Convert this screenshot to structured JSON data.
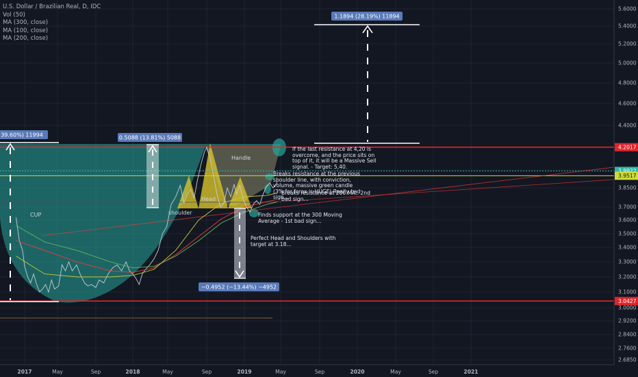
{
  "header": {
    "title": "U.S. Dollar / Brazilian Real, D, IDC",
    "indicators": [
      "Vol (50)",
      "MA (300, close)",
      "MA (100, close)",
      "MA (200, close)"
    ]
  },
  "chart_data": {
    "type": "line",
    "ylim": [
      2.66,
      5.67
    ],
    "y_ticks": [
      2.685,
      2.76,
      2.84,
      2.92,
      3.0,
      3.1,
      3.2,
      3.3,
      3.4,
      3.5,
      3.6,
      3.7,
      3.85,
      4.0,
      4.2,
      4.4,
      4.6,
      4.8,
      5.0,
      5.2,
      5.4,
      5.6
    ],
    "x_ticks": [
      "2017",
      "May",
      "Sep",
      "2018",
      "May",
      "Sep",
      "2019",
      "May",
      "Sep",
      "2020",
      "May",
      "Sep",
      "2021"
    ],
    "price_tags": [
      {
        "value": "4.2017",
        "color": "#e0262b"
      },
      {
        "value": "3.9922",
        "color": "#2fb7a8"
      },
      {
        "value": "3.9517",
        "color": "#cddc39"
      },
      {
        "value": "3.0427",
        "color": "#e0262b"
      }
    ],
    "measure_boxes": [
      {
        "label": "1.1894 (28.19%) 11894"
      },
      {
        "label": "39.60%) 11994"
      },
      {
        "label": "0.5088 (13.81%) 5088"
      },
      {
        "label": "−0.4952 (−13.44%) −4952"
      }
    ],
    "series": [
      {
        "name": "",
        "kind": "price",
        "color": "#c7ccd6",
        "points": [
          [
            2016.92,
            3.62
          ],
          [
            2016.95,
            3.45
          ],
          [
            2016.98,
            3.38
          ],
          [
            2017.0,
            3.27
          ],
          [
            2017.03,
            3.2
          ],
          [
            2017.06,
            3.16
          ],
          [
            2017.09,
            3.22
          ],
          [
            2017.12,
            3.15
          ],
          [
            2017.15,
            3.1
          ],
          [
            2017.18,
            3.12
          ],
          [
            2017.21,
            3.15
          ],
          [
            2017.24,
            3.1
          ],
          [
            2017.27,
            3.18
          ],
          [
            2017.3,
            3.12
          ],
          [
            2017.34,
            3.14
          ],
          [
            2017.37,
            3.28
          ],
          [
            2017.4,
            3.24
          ],
          [
            2017.43,
            3.3
          ],
          [
            2017.46,
            3.24
          ],
          [
            2017.5,
            3.28
          ],
          [
            2017.53,
            3.22
          ],
          [
            2017.57,
            3.16
          ],
          [
            2017.6,
            3.14
          ],
          [
            2017.63,
            3.15
          ],
          [
            2017.67,
            3.13
          ],
          [
            2017.7,
            3.18
          ],
          [
            2017.74,
            3.16
          ],
          [
            2017.78,
            3.22
          ],
          [
            2017.82,
            3.26
          ],
          [
            2017.86,
            3.28
          ],
          [
            2017.9,
            3.24
          ],
          [
            2017.94,
            3.3
          ],
          [
            2017.97,
            3.24
          ],
          [
            2018.0,
            3.22
          ],
          [
            2018.03,
            3.19
          ],
          [
            2018.06,
            3.15
          ],
          [
            2018.09,
            3.22
          ],
          [
            2018.12,
            3.25
          ],
          [
            2018.16,
            3.28
          ],
          [
            2018.2,
            3.32
          ],
          [
            2018.24,
            3.38
          ],
          [
            2018.28,
            3.5
          ],
          [
            2018.32,
            3.55
          ],
          [
            2018.36,
            3.72
          ],
          [
            2018.4,
            3.78
          ],
          [
            2018.44,
            3.87
          ],
          [
            2018.47,
            3.73
          ],
          [
            2018.5,
            3.8
          ],
          [
            2018.53,
            3.84
          ],
          [
            2018.56,
            3.77
          ],
          [
            2018.59,
            3.92
          ],
          [
            2018.62,
            4.05
          ],
          [
            2018.65,
            4.16
          ],
          [
            2018.67,
            4.2
          ],
          [
            2018.7,
            4.1
          ],
          [
            2018.73,
            3.95
          ],
          [
            2018.76,
            3.8
          ],
          [
            2018.79,
            3.7
          ],
          [
            2018.82,
            3.73
          ],
          [
            2018.85,
            3.85
          ],
          [
            2018.88,
            3.78
          ],
          [
            2018.91,
            3.88
          ],
          [
            2018.93,
            3.8
          ],
          [
            2018.96,
            3.87
          ],
          [
            2018.99,
            3.76
          ],
          [
            2019.02,
            3.7
          ],
          [
            2019.05,
            3.66
          ],
          [
            2019.08,
            3.72
          ],
          [
            2019.11,
            3.75
          ],
          [
            2019.14,
            3.72
          ],
          [
            2019.17,
            3.8
          ],
          [
            2019.2,
            3.86
          ],
          [
            2019.23,
            3.89
          ],
          [
            2019.26,
            3.85
          ],
          [
            2019.29,
            3.88
          ],
          [
            2019.3,
            3.91
          ]
        ]
      },
      {
        "name": "",
        "kind": "ma",
        "color": "#ef3b3b",
        "points": [
          [
            2016.92,
            3.45
          ],
          [
            2017.2,
            3.38
          ],
          [
            2017.5,
            3.3
          ],
          [
            2017.8,
            3.24
          ],
          [
            2018.0,
            3.23
          ],
          [
            2018.2,
            3.26
          ],
          [
            2018.4,
            3.35
          ],
          [
            2018.6,
            3.48
          ],
          [
            2018.8,
            3.61
          ],
          [
            2019.0,
            3.7
          ],
          [
            2019.2,
            3.74
          ],
          [
            2019.3,
            3.76
          ]
        ]
      },
      {
        "name": "",
        "kind": "ma",
        "color": "#c6c93a",
        "points": [
          [
            2016.92,
            3.34
          ],
          [
            2017.2,
            3.22
          ],
          [
            2017.5,
            3.2
          ],
          [
            2017.8,
            3.2
          ],
          [
            2018.0,
            3.21
          ],
          [
            2018.2,
            3.25
          ],
          [
            2018.4,
            3.38
          ],
          [
            2018.6,
            3.6
          ],
          [
            2018.8,
            3.73
          ],
          [
            2019.0,
            3.78
          ],
          [
            2019.2,
            3.79
          ],
          [
            2019.3,
            3.81
          ]
        ]
      },
      {
        "name": "",
        "kind": "ma",
        "color": "#62b95e",
        "points": [
          [
            2016.92,
            3.56
          ],
          [
            2017.2,
            3.44
          ],
          [
            2017.5,
            3.38
          ],
          [
            2017.8,
            3.3
          ],
          [
            2018.0,
            3.26
          ],
          [
            2018.2,
            3.27
          ],
          [
            2018.4,
            3.34
          ],
          [
            2018.6,
            3.45
          ],
          [
            2018.8,
            3.58
          ],
          [
            2019.0,
            3.66
          ],
          [
            2019.2,
            3.72
          ],
          [
            2019.3,
            3.74
          ]
        ]
      }
    ],
    "levels": [
      {
        "value": 4.2017,
        "color": "#e0262b"
      },
      {
        "value": 3.0427,
        "color": "#e0262b"
      },
      {
        "value": 3.9922,
        "color": "#2fb7a8"
      },
      {
        "value": 3.9517,
        "color": "#cddc39"
      }
    ]
  },
  "labels": {
    "cup": "CUP",
    "handle": "Handle",
    "head": "Head",
    "shoulder": "shoulder"
  },
  "annotations": {
    "resistance_note": "If the last resistance at 4,20 is\novercome, and the price sits on\ntop of it, it will be a Massive Sell\nsignal. - Target: 5,40.",
    "breaks_note": "Breaks resistance at the previous\nshoulder line, with conviction,\nvolume, massive green candle\n(3% for forex is HUGE) Really bad\nsign...",
    "ma200_note": "Breaks resistance at 200 MA.. 2nd\nbad sign...",
    "support_note": "Finds support at the 300 Moving\nAverage - 1st bad sign...",
    "hs_note": "Perfect Head and Shoulders with\ntarget at 3.18..."
  }
}
